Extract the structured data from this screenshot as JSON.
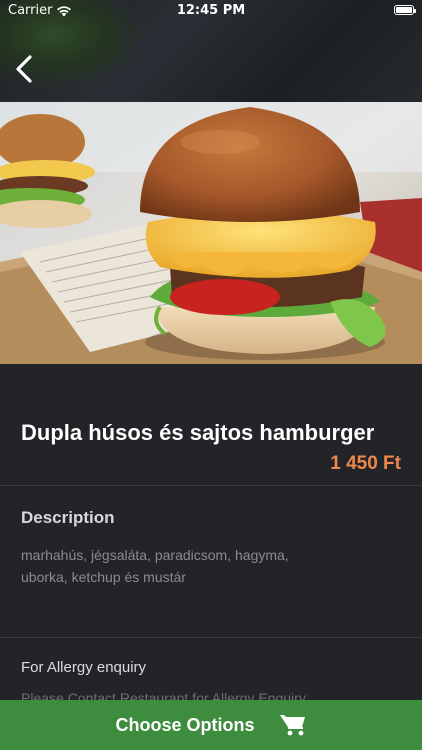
{
  "status_bar": {
    "carrier": "Carrier",
    "time": "12:45 PM"
  },
  "product": {
    "title": "Dupla húsos és sajtos hamburger",
    "price": "1 450 Ft"
  },
  "description": {
    "heading": "Description",
    "lines": [
      "marhahús, jégsaláta, paradicsom, hagyma,",
      "uborka, ketchup és mustár"
    ]
  },
  "allergy": {
    "heading": "For Allergy enquiry",
    "text": "Please Contact Restaurant for Allergy Enquiry"
  },
  "cta": {
    "label": "Choose Options"
  },
  "colors": {
    "price": "#f0884c",
    "cta_background": "#3e8d3e",
    "background": "#232428"
  },
  "icons": {
    "back": "chevron-left-icon",
    "cart": "cart-icon",
    "wifi": "wifi-icon",
    "battery": "battery-icon"
  }
}
